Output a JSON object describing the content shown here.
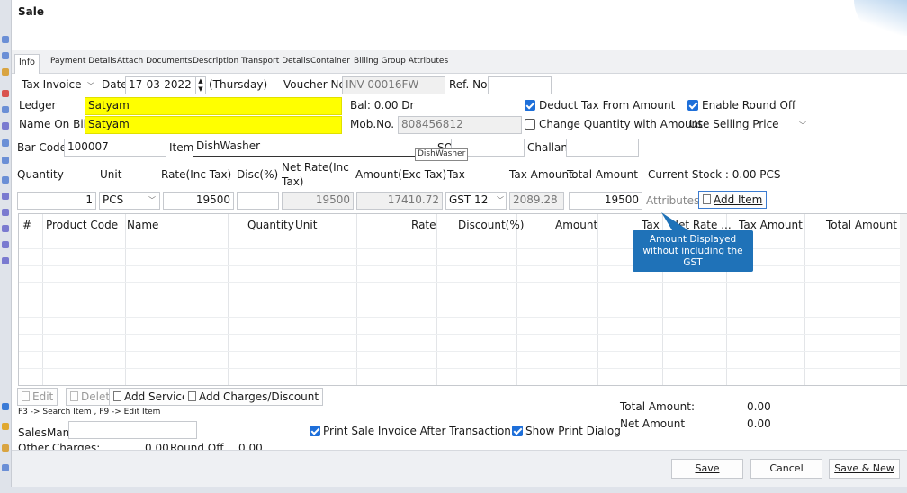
{
  "window": {
    "title": "Sale"
  },
  "tabs": [
    "Info",
    "Payment Details",
    "Attach Documents",
    "Description",
    "Transport Details",
    "Container",
    "Billing Group Attributes"
  ],
  "header": {
    "invoice_type": "Tax Invoice",
    "date_label": "Date",
    "date_value": "17-03-2022",
    "day": "(Thursday)",
    "voucher_label": "Voucher No",
    "voucher_value": "INV-00016FW",
    "ref_label": "Ref. No.",
    "ref_value": ""
  },
  "party": {
    "ledger_label": "Ledger",
    "ledger_value": "Satyam",
    "bal_text": "Bal: 0.00 Dr",
    "name_on_bill_label": "Name On Bill",
    "name_on_bill_value": "Satyam",
    "mob_label": "Mob.No.",
    "mob_value": "808456812"
  },
  "options": {
    "deduct_tax": "Deduct Tax From Amount",
    "round_off": "Enable Round Off",
    "change_qty": "Change Quantity with Amount",
    "price_mode": "Use Selling Price"
  },
  "item_entry": {
    "barcode_label": "Bar Code",
    "barcode_value": "100007",
    "item_label": "Item",
    "item_value": "DishWasher",
    "suggestion": "DishWasher",
    "so_label": "SO",
    "challan_label": "Challan",
    "col_quantity": "Quantity",
    "col_unit": "Unit",
    "col_rate": "Rate(Inc Tax)",
    "col_disc": "Disc(%)",
    "col_netrate_1": "Net Rate(Inc",
    "col_netrate_2": "Tax)",
    "col_amount": "Amount(Exc Tax)",
    "col_tax": "Tax",
    "col_taxamount": "Tax Amount",
    "col_totalamount": "Total Amount",
    "current_stock": "Current Stock :  0.00 PCS",
    "quantity": "1",
    "unit": "PCS",
    "rate": "19500",
    "disc": "",
    "net_rate": "19500",
    "amount": "17410.72",
    "tax": "GST 12",
    "tax_amount": "2089.28",
    "total_amount": "19500",
    "attributes_label": "Attributes",
    "add_item_label": "Add Item"
  },
  "grid": {
    "headers": [
      "#",
      "Product Code",
      "Name",
      "Quantity",
      "Unit",
      "Rate",
      "Discount(%)",
      "Amount",
      "Tax",
      "Net Rate ...",
      "Tax Amount",
      "Total Amount"
    ]
  },
  "tooltip": {
    "line1": "Amount Displayed",
    "line2": "without including the",
    "line3": "GST"
  },
  "actions": {
    "edit": "Edit",
    "delete": "Delete",
    "add_service": "Add Service",
    "add_charges": "Add Charges/Discount",
    "hint": "F3 -> Search Item , F9 -> Edit Item"
  },
  "bottom": {
    "salesman_label": "SalesMan",
    "salesman_value": "",
    "print_invoice": "Print Sale Invoice After Transaction",
    "show_print": "Show Print Dialog",
    "other_charges_label": "Other Charges:",
    "other_charges_value": "0.00",
    "round_off_label": "Round Off",
    "round_off_value": "0.00",
    "total_amount_label": "Total Amount:",
    "total_amount_value": "0.00",
    "net_amount_label": "Net Amount",
    "net_amount_value": "0.00"
  },
  "footer": {
    "save": "Save",
    "cancel": "Cancel",
    "save_new": "Save & New"
  },
  "colors": {
    "accent": "#1e6fd9",
    "highlight": "#ffff00",
    "tooltip": "#1f72b8"
  }
}
